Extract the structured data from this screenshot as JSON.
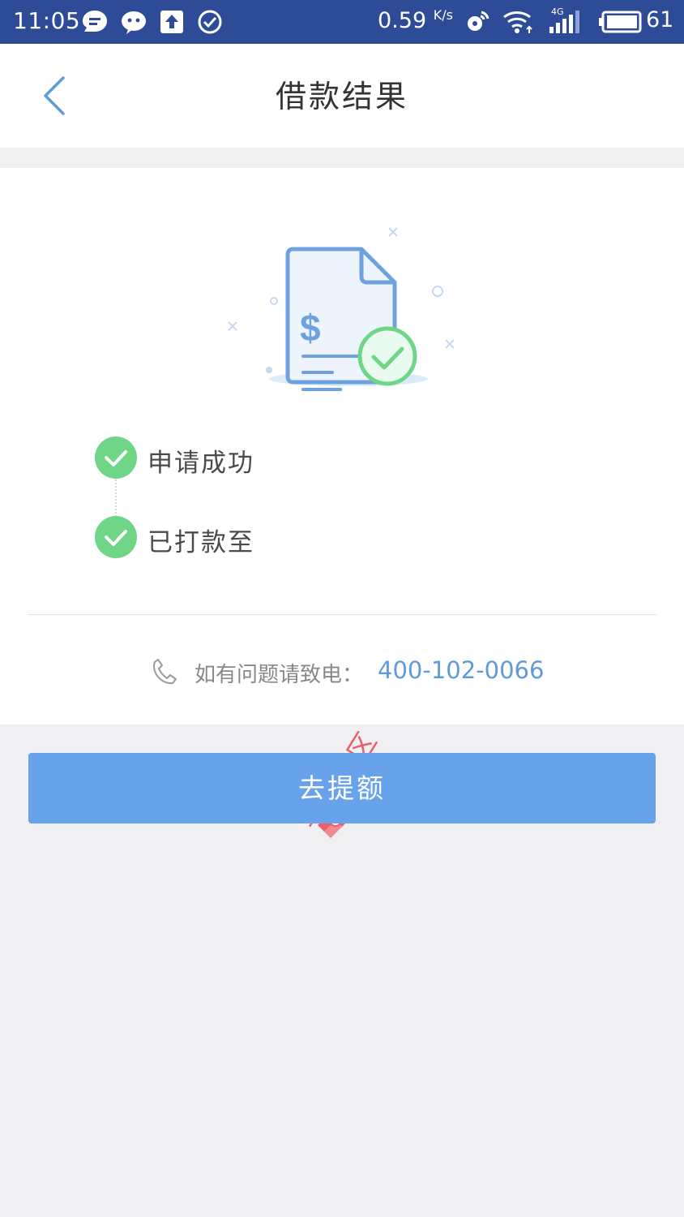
{
  "status_bar": {
    "time": "11:05",
    "net_speed": "0.59",
    "net_speed_unit": "K/s",
    "network_type": "4G",
    "battery_level": "61",
    "notification_icons": [
      "chat-bubble-icon",
      "wechat-icon",
      "upload-icon",
      "check-circle-icon"
    ],
    "system_icons": [
      "hotspot-icon",
      "wifi-icon",
      "signal-icon",
      "battery-icon"
    ]
  },
  "nav": {
    "title": "借款结果",
    "back_icon": "chevron-left-icon"
  },
  "illustration": {
    "icon": "invoice-success-icon",
    "symbol": "$"
  },
  "steps": [
    {
      "label": "申请成功",
      "status": "done"
    },
    {
      "label": "已打款至",
      "status": "done"
    }
  ],
  "contact": {
    "label": "如有问题请致电：",
    "phone": "400-102-0066",
    "icon": "phone-icon"
  },
  "watermark": {
    "text": "卡农社区"
  },
  "primary_action": {
    "label": "去提额"
  },
  "colors": {
    "status_bar": "#2e4b98",
    "accent_blue": "#68a2ea",
    "link_blue": "#5f9ad9",
    "success_green": "#6fd688",
    "background": "#f0f0f2"
  }
}
